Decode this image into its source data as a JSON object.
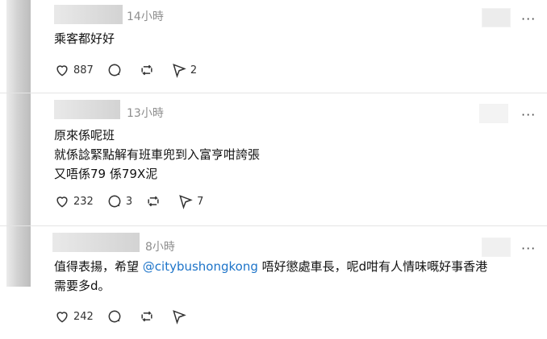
{
  "posts": [
    {
      "time": "14小時",
      "lines": [
        "乘客都好好"
      ],
      "likes": "887",
      "replies": "",
      "reposts": "",
      "shares": "2"
    },
    {
      "time": "13小時",
      "lines": [
        "原來係呢班",
        "就係諗緊點解有班車兜到入富亨咁誇張",
        "又唔係79 係79X泥"
      ],
      "likes": "232",
      "replies": "3",
      "reposts": "",
      "shares": "7"
    },
    {
      "time": "8小時",
      "text_before": "值得表揚，希望 ",
      "mention": "@citybushongkong",
      "text_after": " 唔好懲處車長，呢d咁有人情味嘅好事香港",
      "text_line2": "需要多d。",
      "likes": "242",
      "replies": "",
      "reposts": "",
      "shares": ""
    }
  ],
  "more_label": "···",
  "icons": [
    "heart-icon",
    "comment-icon",
    "repost-icon",
    "send-icon"
  ]
}
